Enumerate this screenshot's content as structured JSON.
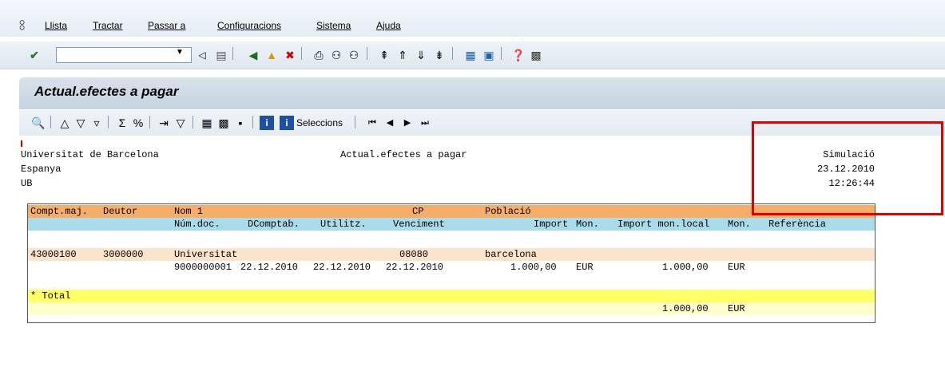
{
  "menubar": {
    "items": [
      "Llista",
      "Tractar",
      "Passar a",
      "Configuracions",
      "Sistema",
      "Ajuda"
    ]
  },
  "toolbar": {
    "command_value": "",
    "icons": [
      "enter-icon",
      "back-icon",
      "save-icon",
      "back-green-icon",
      "exit-icon",
      "cancel-icon",
      "print-icon",
      "find-icon",
      "find-next-icon",
      "first-page-icon",
      "prev-page-icon",
      "next-page-icon",
      "last-page-icon",
      "create-session-icon",
      "shortcut-icon",
      "help-icon",
      "layout-icon"
    ]
  },
  "page": {
    "title": "Actual.efectes a pagar"
  },
  "report_toolbar": {
    "seleccions_label": "Seleccions"
  },
  "header": {
    "company": "Universitat de Barcelona",
    "country": "Espanya",
    "code": "UB",
    "center_title": "Actual.efectes a pagar",
    "mode": "Simulació",
    "date": "23.12.2010",
    "time": "12:26:44"
  },
  "columns": {
    "row1": [
      "Compt.maj.",
      "Deutor",
      "Nom 1",
      "CP",
      "Població"
    ],
    "row2": [
      "Núm.doc.",
      "DComptab.",
      "Utilitz.",
      "Venciment",
      "Import",
      "Mon.",
      "Import mon.local",
      "Mon.",
      "Referència"
    ]
  },
  "entries": [
    {
      "account": "43000100",
      "debtor": "3000000",
      "name": "Universitat",
      "cp": "08080",
      "city": "barcelona",
      "doc_no": "9000000001",
      "posting_date": "22.12.2010",
      "used_date": "22.12.2010",
      "due_date": "22.12.2010",
      "amount": "1.000,00",
      "currency": "EUR",
      "local_amount": "1.000,00",
      "local_currency": "EUR"
    }
  ],
  "total": {
    "label": "* Total",
    "local_amount": "1.000,00",
    "local_currency": "EUR"
  },
  "colors": {
    "header_row1": "#f7ad6a",
    "header_row2": "#a8dcea",
    "entry_row": "#fbe3cc",
    "total_row1": "#ffff66",
    "total_row2": "#ffffcc",
    "highlight": "#e00000"
  }
}
